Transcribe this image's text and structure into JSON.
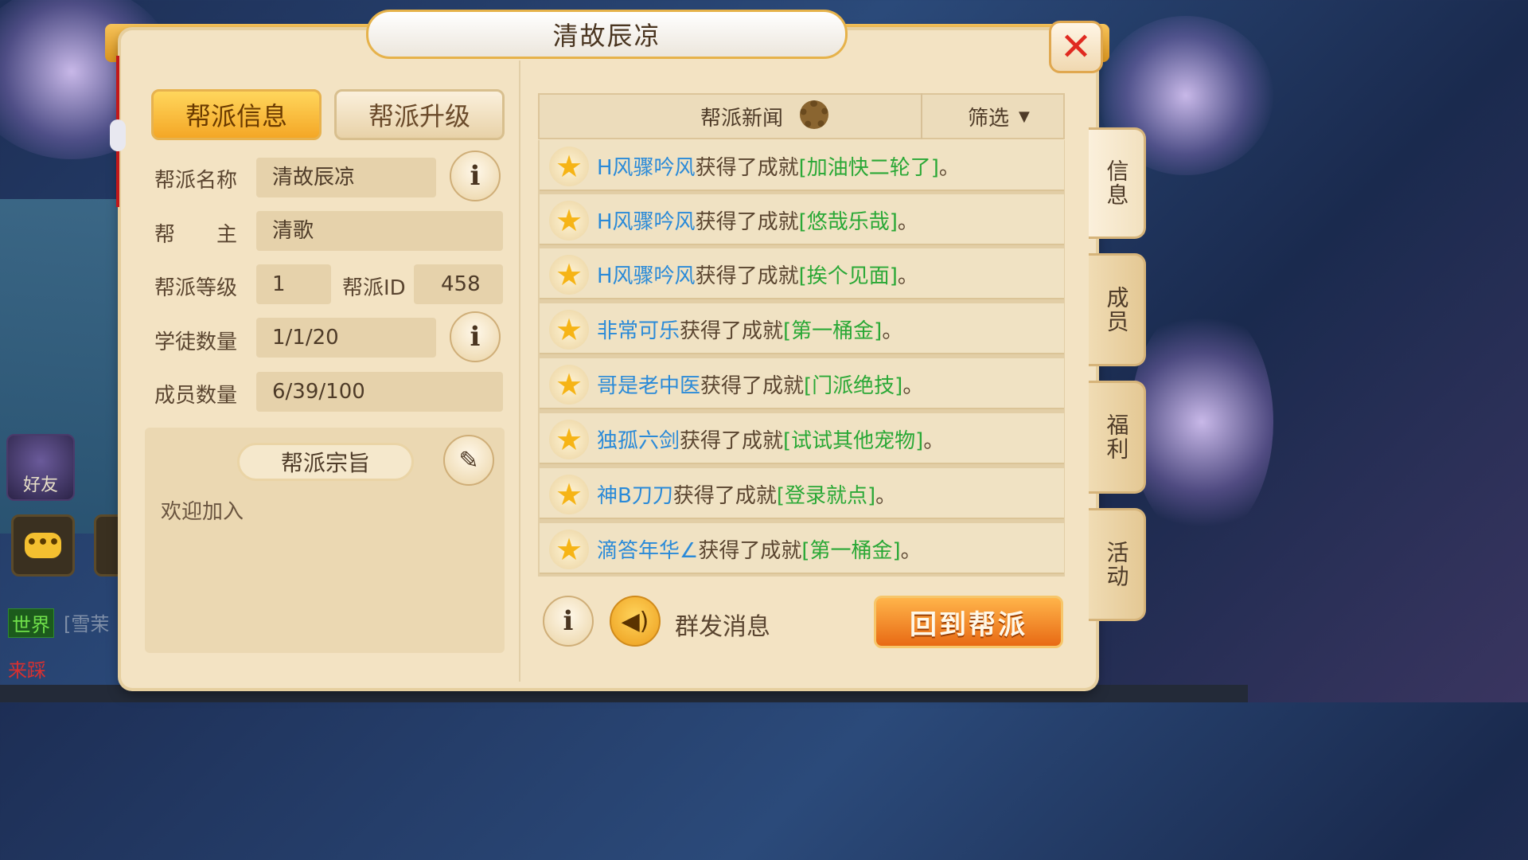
{
  "window": {
    "title": "清故辰凉",
    "close_icon": "close-icon"
  },
  "tabs": [
    {
      "label": "帮派信息",
      "active": true
    },
    {
      "label": "帮派升级",
      "active": false
    }
  ],
  "guild_info": {
    "name_label": "帮派名称",
    "name_value": "清故辰凉",
    "leader_label": "帮　　主",
    "leader_value": "清歌",
    "level_label": "帮派等级",
    "level_value": "1",
    "id_label": "帮派ID",
    "id_value": "458",
    "apprentice_label": "学徒数量",
    "apprentice_value": "1/1/20",
    "member_label": "成员数量",
    "member_value": "6/39/100"
  },
  "motto": {
    "title": "帮派宗旨",
    "text": "欢迎加入"
  },
  "news": {
    "title": "帮派新闻",
    "filter_label": "筛选",
    "items": [
      {
        "name": "H风骤吟风",
        "mid": "获得了成就",
        "achievement": "[加油快二轮了]",
        "end": "。"
      },
      {
        "name": "H风骤吟风",
        "mid": "获得了成就",
        "achievement": "[悠哉乐哉]",
        "end": "。"
      },
      {
        "name": "H风骤吟风",
        "mid": "获得了成就",
        "achievement": "[挨个见面]",
        "end": "。"
      },
      {
        "name": "非常可乐",
        "mid": "获得了成就",
        "achievement": "[第一桶金]",
        "end": "。"
      },
      {
        "name": "哥是老中医",
        "mid": "获得了成就",
        "achievement": "[门派绝技]",
        "end": "。"
      },
      {
        "name": "独孤六剑",
        "mid": "获得了成就",
        "achievement": "[试试其他宠物]",
        "end": "。"
      },
      {
        "name": "神B刀刀",
        "mid": "获得了成就",
        "achievement": "[登录就点]",
        "end": "。"
      },
      {
        "name": "滴答年华∠",
        "mid": "获得了成就",
        "achievement": "[第一桶金]",
        "end": "。"
      }
    ]
  },
  "bottom": {
    "mass_message_label": "群发消息",
    "return_button_label": "回到帮派"
  },
  "side_tabs": [
    {
      "label": "信息",
      "active": true
    },
    {
      "label": "成员",
      "active": false
    },
    {
      "label": "福利",
      "active": false
    },
    {
      "label": "活动",
      "active": false
    }
  ],
  "background_ui": {
    "friend_label": "好友",
    "world_tag": "世界",
    "world_text": "[雪茉",
    "laicai": "来踩"
  },
  "colors": {
    "name": "#2a8ad8",
    "achievement": "#2aa836",
    "close": "#e02a20",
    "accent": "#f4a726"
  }
}
